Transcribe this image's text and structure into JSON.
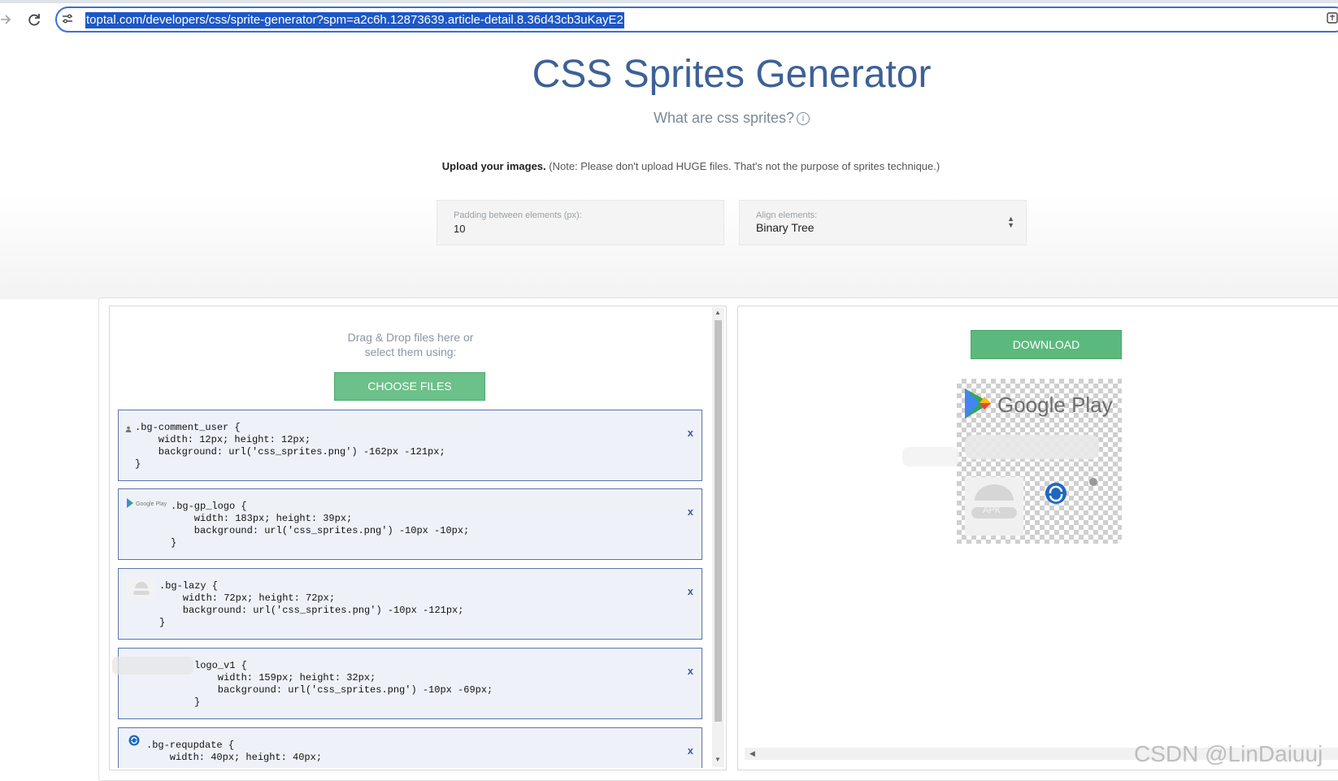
{
  "browser": {
    "url": "toptal.com/developers/css/sprite-generator?spm=a2c6h.12873639.article-detail.8.36d43cb3uKayE2"
  },
  "header": {
    "title": "CSS Sprites Generator",
    "what_are": "What are css sprites?",
    "upload_bold": "Upload your images.",
    "upload_note": " (Note: Please don't upload HUGE files. That's not the purpose of sprites technique.)"
  },
  "options": {
    "padding_label": "Padding between elements (px):",
    "padding_value": "10",
    "align_label": "Align elements:",
    "align_value": "Binary Tree"
  },
  "upload": {
    "drag_drop_text": "Drag & Drop files here or\nselect them using:",
    "choose_files_label": "CHOOSE FILES"
  },
  "entries": [
    {
      "thumb_icon": "user-icon",
      "code": ".bg-comment_user {\n    width: 12px; height: 12px;\n    background: url('css_sprites.png') -162px -121px;\n}",
      "remove": "x"
    },
    {
      "thumb_icon": "google-play-logo",
      "code": ".bg-gp_logo {\n    width: 183px; height: 39px;\n    background: url('css_sprites.png') -10px -10px;\n}",
      "remove": "x"
    },
    {
      "thumb_icon": "android-apk-icon",
      "code": ".bg-lazy {\n    width: 72px; height: 72px;\n    background: url('css_sprites.png') -10px -121px;\n}",
      "remove": "x"
    },
    {
      "thumb_icon": "blurred-logo",
      "code": "logo_v1 {\n    width: 159px; height: 32px;\n    background: url('css_sprites.png') -10px -69px;\n}",
      "remove": "x"
    },
    {
      "thumb_icon": "refresh-icon",
      "code": ".bg-requpdate {\n    width: 40px; height: 40px;",
      "remove": "x"
    }
  ],
  "preview": {
    "download_label": "DOWNLOAD",
    "google_play_text": "Google Play",
    "apk_text": "APK"
  },
  "watermark": "CSDN @LinDaiuuj",
  "colors": {
    "title": "#3d6196",
    "green_button": "#5cb97d",
    "entry_border": "#5a74a8",
    "url_highlight": "#1d57c6"
  }
}
